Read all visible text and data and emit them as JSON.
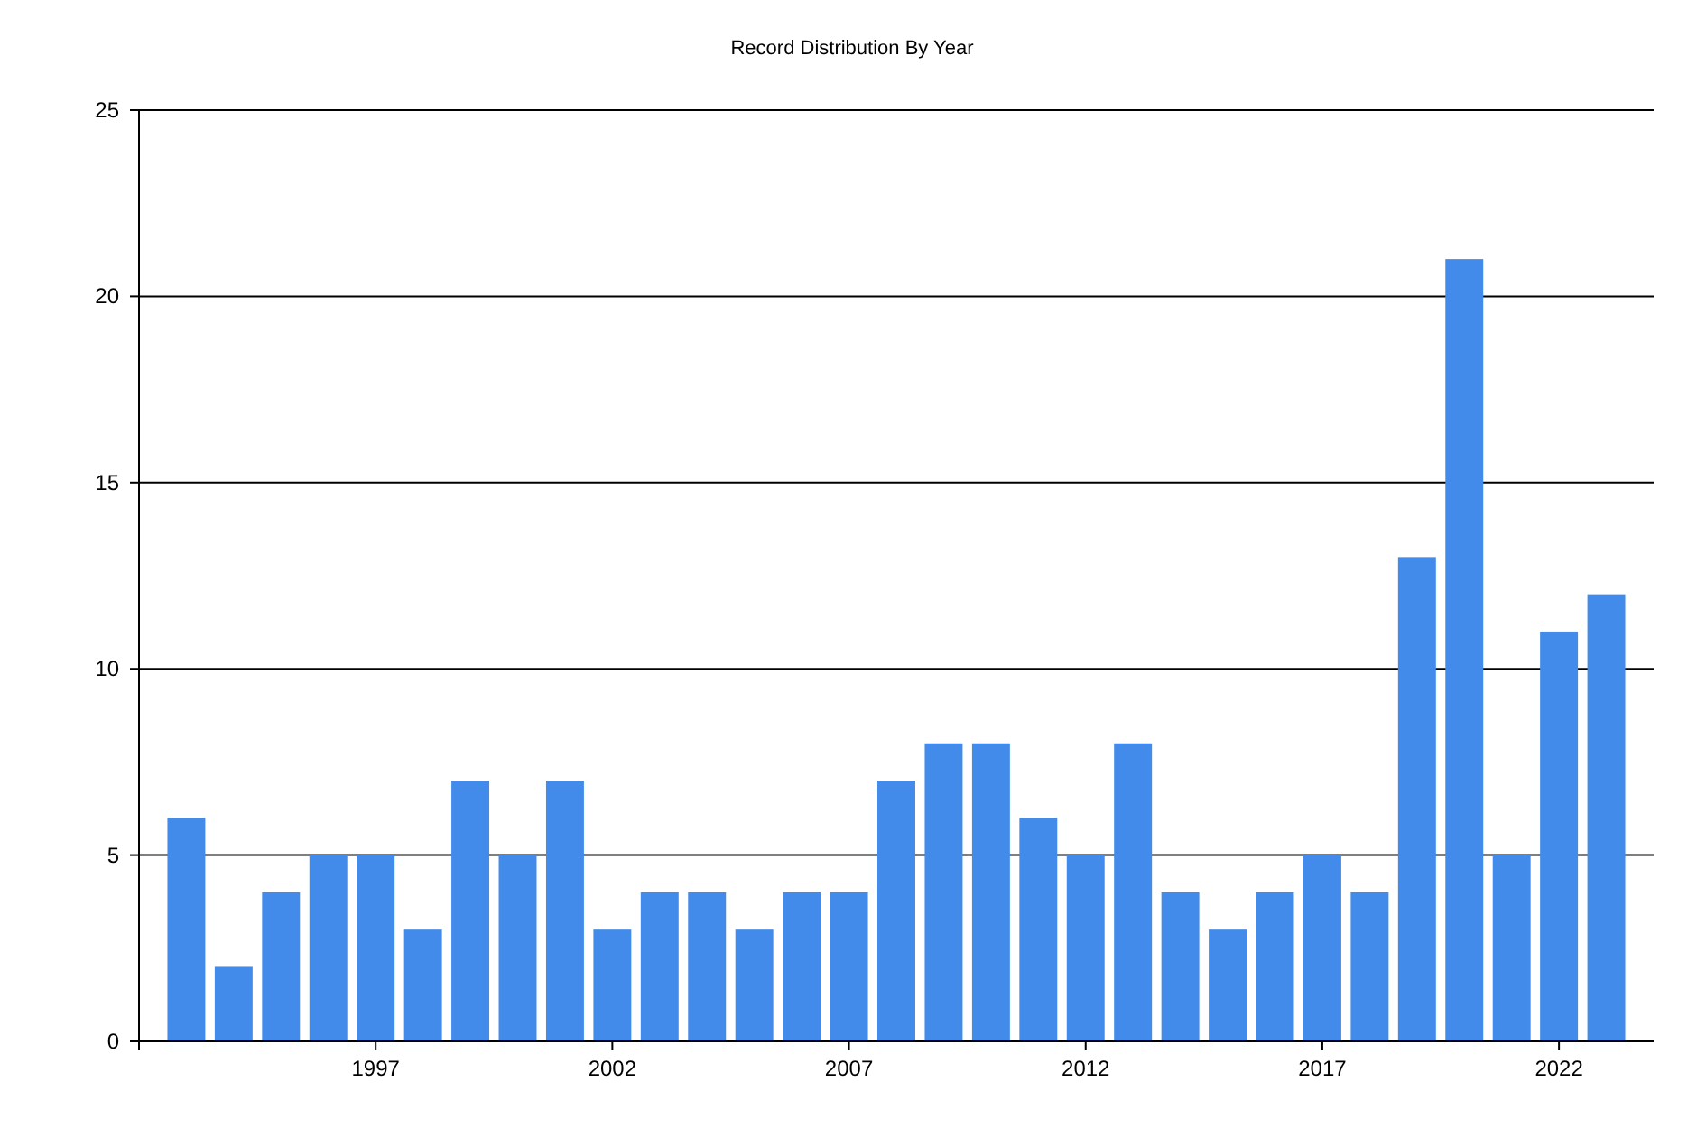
{
  "chart": {
    "chart_data": {
      "type": "bar",
      "title": "Record Distribution By Year",
      "x": [
        1993,
        1994,
        1995,
        1996,
        1997,
        1998,
        1999,
        2000,
        2001,
        2002,
        2003,
        2004,
        2005,
        2006,
        2007,
        2008,
        2009,
        2010,
        2011,
        2012,
        2013,
        2014,
        2015,
        2016,
        2017,
        2018,
        2019,
        2020,
        2021,
        2022,
        2023
      ],
      "series": [
        {
          "color": "#428bea",
          "values": [
            6,
            2,
            4,
            5,
            5,
            3,
            7,
            5,
            7,
            3,
            4,
            4,
            3,
            4,
            4,
            7,
            8,
            8,
            6,
            5,
            8,
            4,
            3,
            4,
            5,
            4,
            13,
            21,
            5,
            11,
            12
          ]
        }
      ],
      "xlim": [
        1992,
        2024
      ],
      "ylim": [
        0,
        25
      ],
      "yticks": [
        {
          "value": 0,
          "label": "0"
        },
        {
          "value": 5,
          "label": "5"
        },
        {
          "value": 10,
          "label": "10"
        },
        {
          "value": 15,
          "label": "15"
        },
        {
          "value": 20,
          "label": "20"
        },
        {
          "value": 25,
          "label": "25"
        }
      ],
      "xticks": [
        1997,
        2002,
        2007,
        2012,
        2017,
        2022
      ],
      "grid": true
    }
  }
}
